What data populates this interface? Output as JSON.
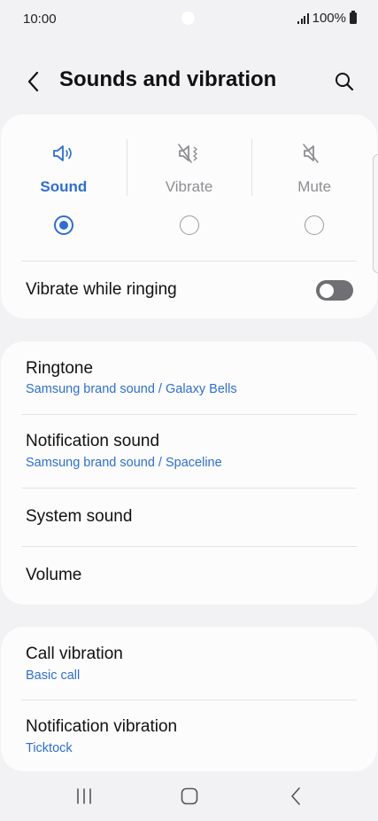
{
  "status_bar": {
    "time": "10:00",
    "battery_text": "100%",
    "signal_icon": "signal-icon",
    "battery_icon": "battery-icon"
  },
  "header": {
    "title": "Sounds and vibration",
    "back_icon": "back-arrow-icon",
    "search_icon": "search-icon"
  },
  "sound_mode": {
    "selected": "Sound",
    "modes": [
      {
        "label": "Sound",
        "icon": "speaker-sound-icon",
        "selected": true
      },
      {
        "label": "Vibrate",
        "icon": "vibrate-icon",
        "selected": false
      },
      {
        "label": "Mute",
        "icon": "mute-icon",
        "selected": false
      }
    ],
    "vibrate_while_ringing": {
      "label": "Vibrate while ringing",
      "enabled": false
    }
  },
  "sounds_group": [
    {
      "title": "Ringtone",
      "subtitle": "Samsung brand sound / Galaxy Bells"
    },
    {
      "title": "Notification sound",
      "subtitle": "Samsung brand sound / Spaceline"
    },
    {
      "title": "System sound"
    },
    {
      "title": "Volume"
    }
  ],
  "vibration_group": [
    {
      "title": "Call vibration",
      "subtitle": "Basic call"
    },
    {
      "title": "Notification vibration",
      "subtitle": "Ticktock"
    }
  ],
  "nav_bar": {
    "recents_icon": "recents-icon",
    "home_icon": "home-icon",
    "back_icon": "back-icon"
  },
  "colors": {
    "accent": "#2f6fcb",
    "background": "#f2f2f4",
    "card": "#fcfcfd",
    "toggle_off": "#6f6f74"
  }
}
